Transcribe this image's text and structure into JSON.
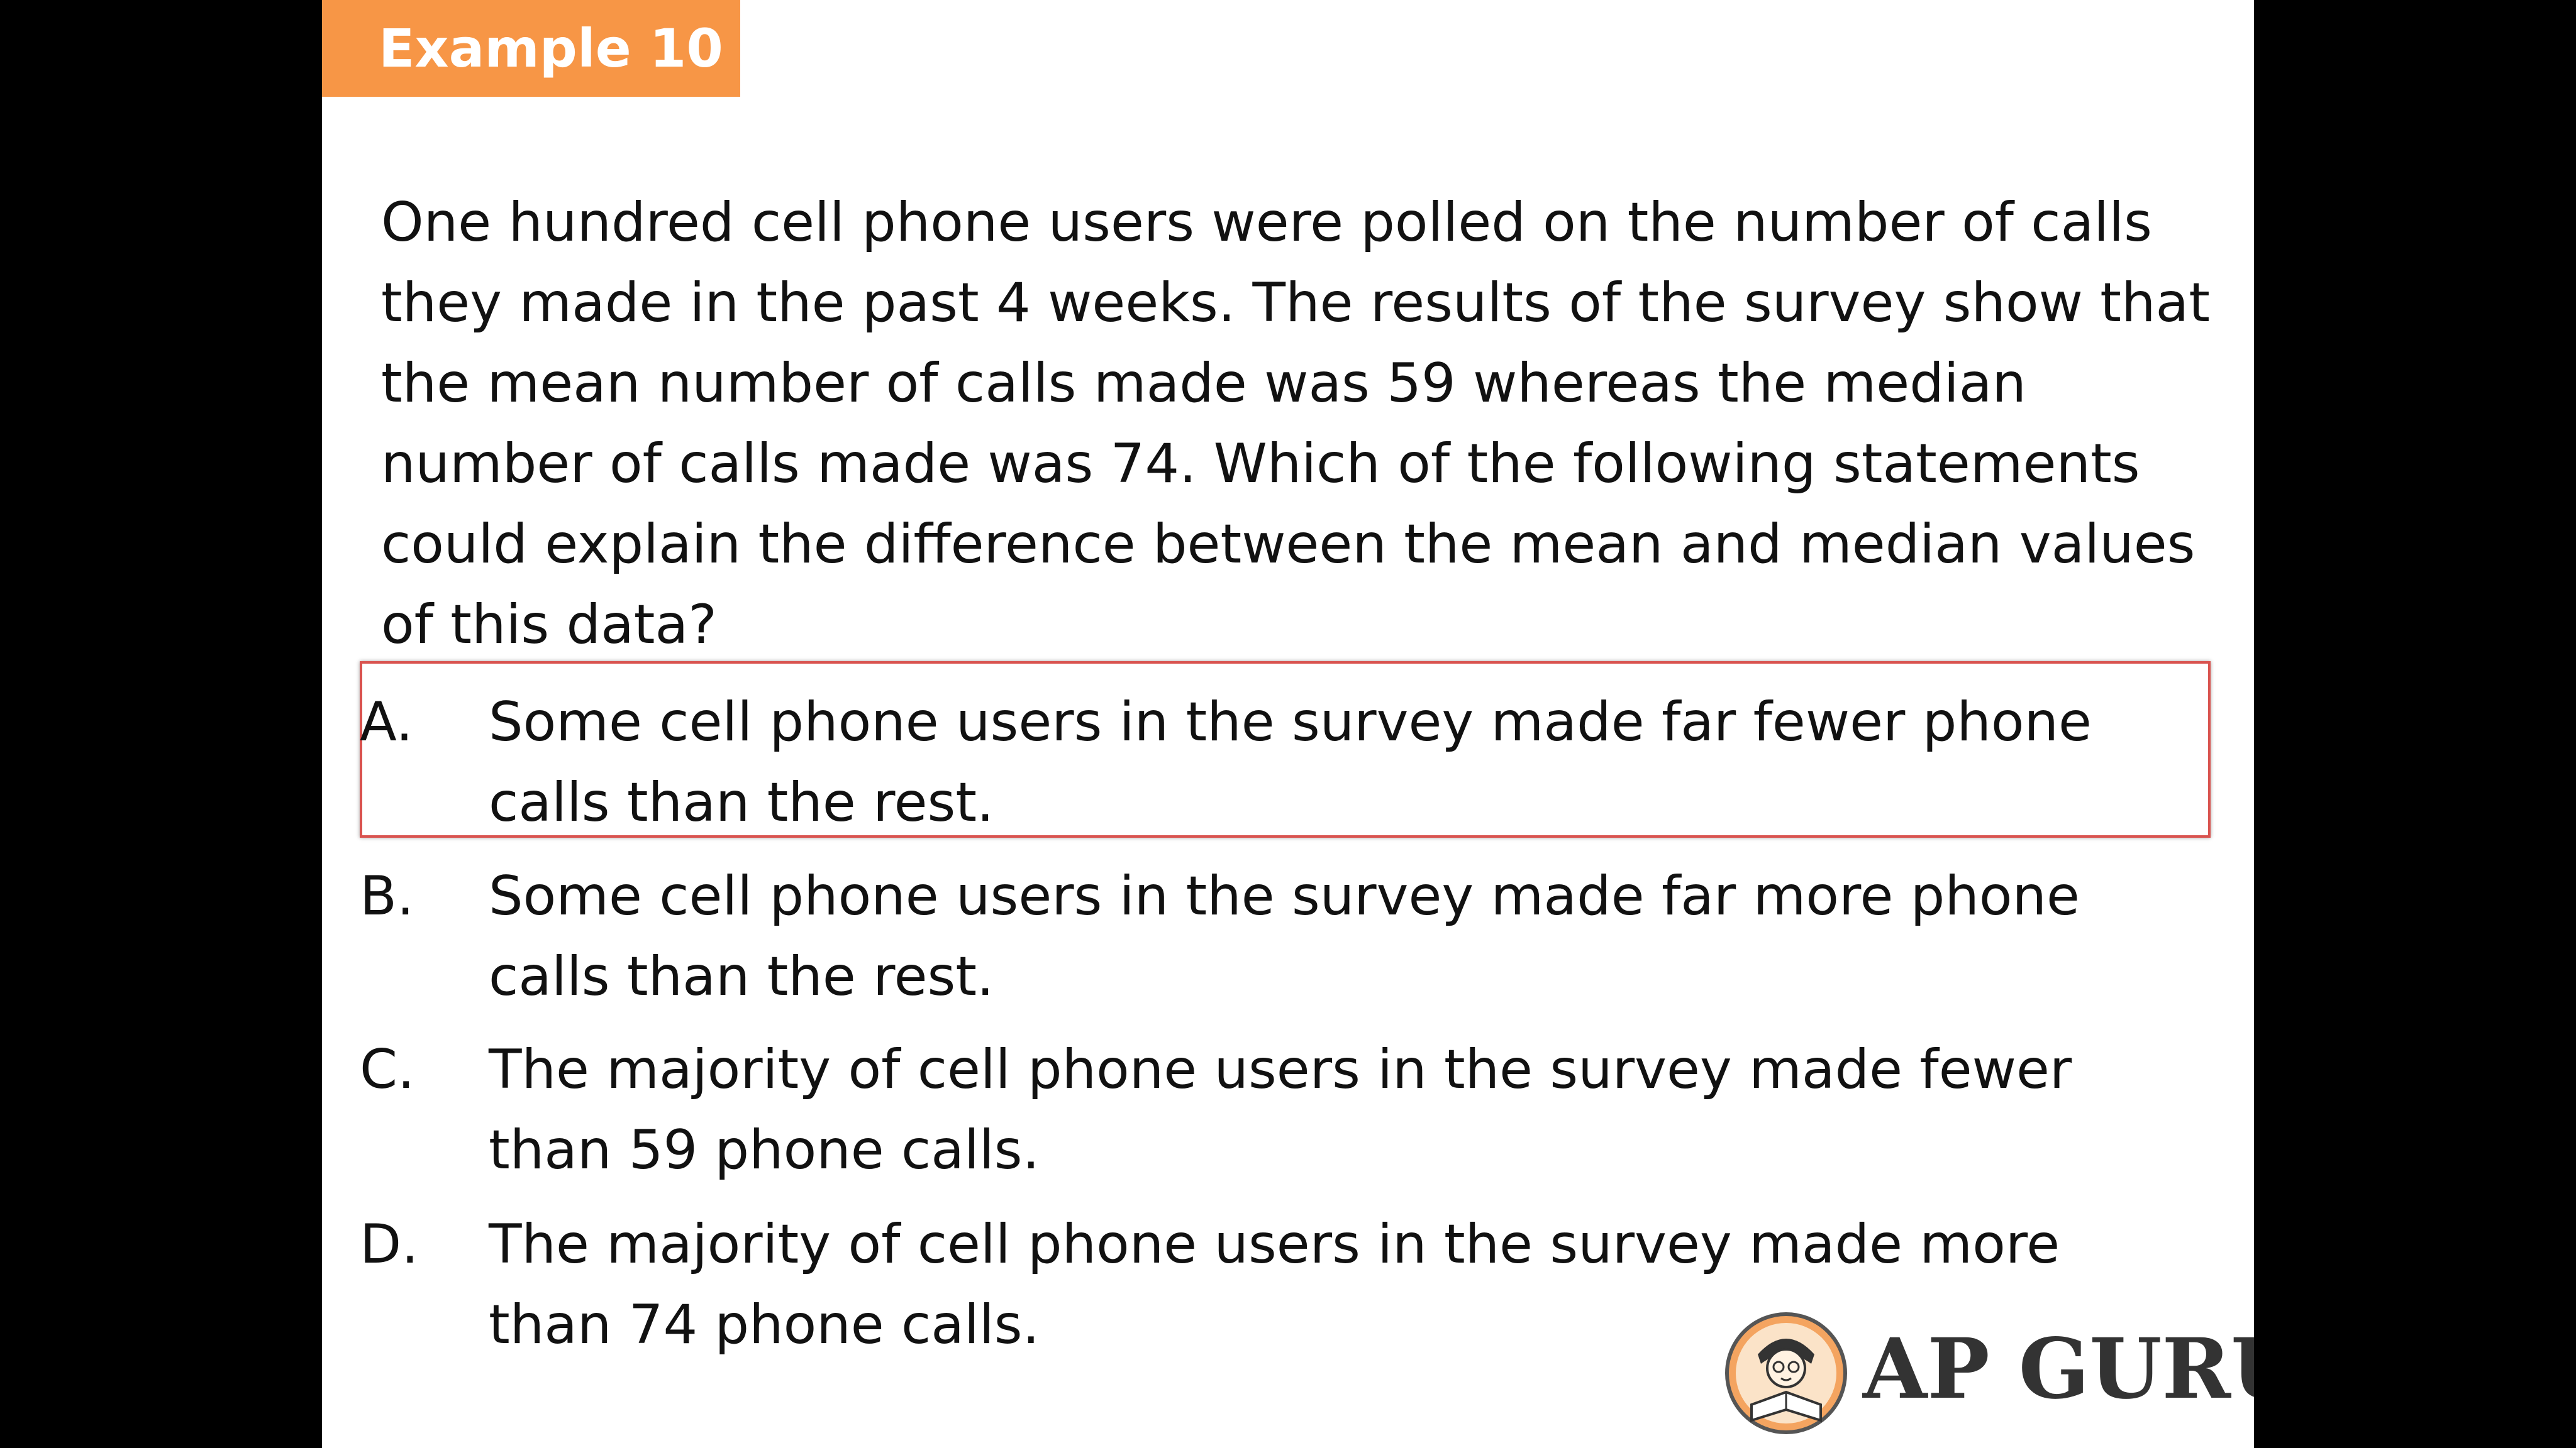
{
  "slide": {
    "tag_label": "Example 10",
    "question": "One hundred cell phone users were polled on the number of calls they made in the past 4 weeks.  The results of the survey show that the mean number of calls made was 59 whereas the median number of calls made was 74.  Which of the following statements could explain the difference between the mean and median values of this data?",
    "options": [
      {
        "letter": "A.",
        "text": "Some cell phone users in the survey made far fewer phone calls than the rest."
      },
      {
        "letter": "B.",
        "text": "Some cell phone users in the survey made far more phone calls than the rest."
      },
      {
        "letter": "C.",
        "text": "The majority of cell phone users in the survey made fewer than 59 phone calls."
      },
      {
        "letter": "D.",
        "text": "The majority of cell phone users in the survey made more than 74 phone calls."
      }
    ],
    "highlighted_option": "A."
  },
  "logo": {
    "text": "AP GURU",
    "icon": "mascot-reading-icon"
  },
  "colors": {
    "tag_background": "#f79646",
    "highlight_border": "#d9534f",
    "slide_background": "#ffffff",
    "letterbox": "#000000"
  }
}
